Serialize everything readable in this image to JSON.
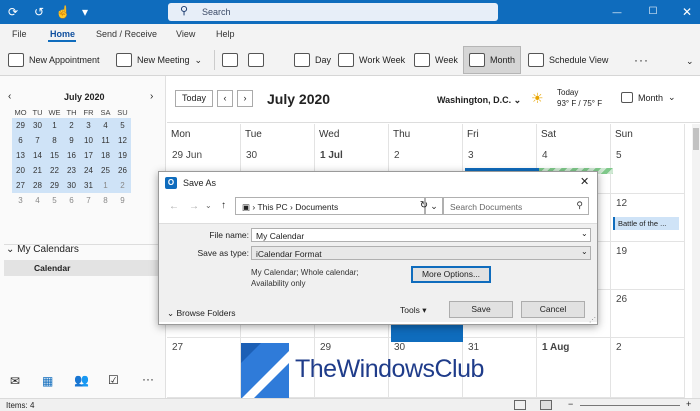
{
  "search": {
    "placeholder": "Search"
  },
  "menu": [
    "File",
    "Home",
    "Send / Receive",
    "View",
    "Help"
  ],
  "ribbon": {
    "new_appointment": "New Appointment",
    "new_meeting": "New Meeting",
    "day": "Day",
    "work_week": "Work Week",
    "week": "Week",
    "month": "Month",
    "schedule_view": "Schedule View",
    "more": "···"
  },
  "mini_calendar": {
    "title": "July 2020",
    "weekdays": [
      "MO",
      "TU",
      "WE",
      "TH",
      "FR",
      "SA",
      "SU"
    ],
    "weeks": [
      [
        "29",
        "30",
        "1",
        "2",
        "3",
        "4",
        "5"
      ],
      [
        "6",
        "7",
        "8",
        "9",
        "10",
        "11",
        "12"
      ],
      [
        "13",
        "14",
        "15",
        "16",
        "17",
        "18",
        "19"
      ],
      [
        "20",
        "21",
        "22",
        "23",
        "24",
        "25",
        "26"
      ],
      [
        "27",
        "28",
        "29",
        "30",
        "31",
        "1",
        "2"
      ],
      [
        "3",
        "4",
        "5",
        "6",
        "7",
        "8",
        "9"
      ]
    ]
  },
  "nav": {
    "my_calendars": "My Calendars",
    "calendar": "Calendar"
  },
  "calendar": {
    "today_button": "Today",
    "title": "July 2020",
    "location": "Washington, D.C.",
    "weather_label": "Today",
    "weather_temp": "93° F / 75° F",
    "view_select": "Month",
    "days": [
      "Mon",
      "Tue",
      "Wed",
      "Thu",
      "Fri",
      "Sat",
      "Sun"
    ],
    "row1": [
      "29 Jun",
      "30",
      "1 Jul",
      "2",
      "3",
      "4",
      "5"
    ],
    "row2_sun": "12",
    "row3_sun": "19",
    "row4_sun": "26",
    "row5": [
      "27",
      "28",
      "29",
      "30",
      "31",
      "1 Aug",
      "2"
    ],
    "event": "Battle of the ..."
  },
  "dialog": {
    "title": "Save As",
    "path": [
      "This PC",
      "Documents"
    ],
    "search_placeholder": "Search Documents",
    "file_name_label": "File name:",
    "file_name": "My Calendar",
    "save_type_label": "Save as type:",
    "save_type": "iCalendar Format",
    "description": "My Calendar; Whole calendar; Availability only",
    "more_options": "More Options...",
    "browse_folders": "Browse Folders",
    "tools": "Tools",
    "save": "Save",
    "cancel": "Cancel"
  },
  "status": {
    "items": "Items: 4"
  },
  "watermark": "TheWindowsClub",
  "colors": {
    "titlebar": "#0f6cbd",
    "accent": "#0f6cbd",
    "selection": "#cfe3f7"
  }
}
